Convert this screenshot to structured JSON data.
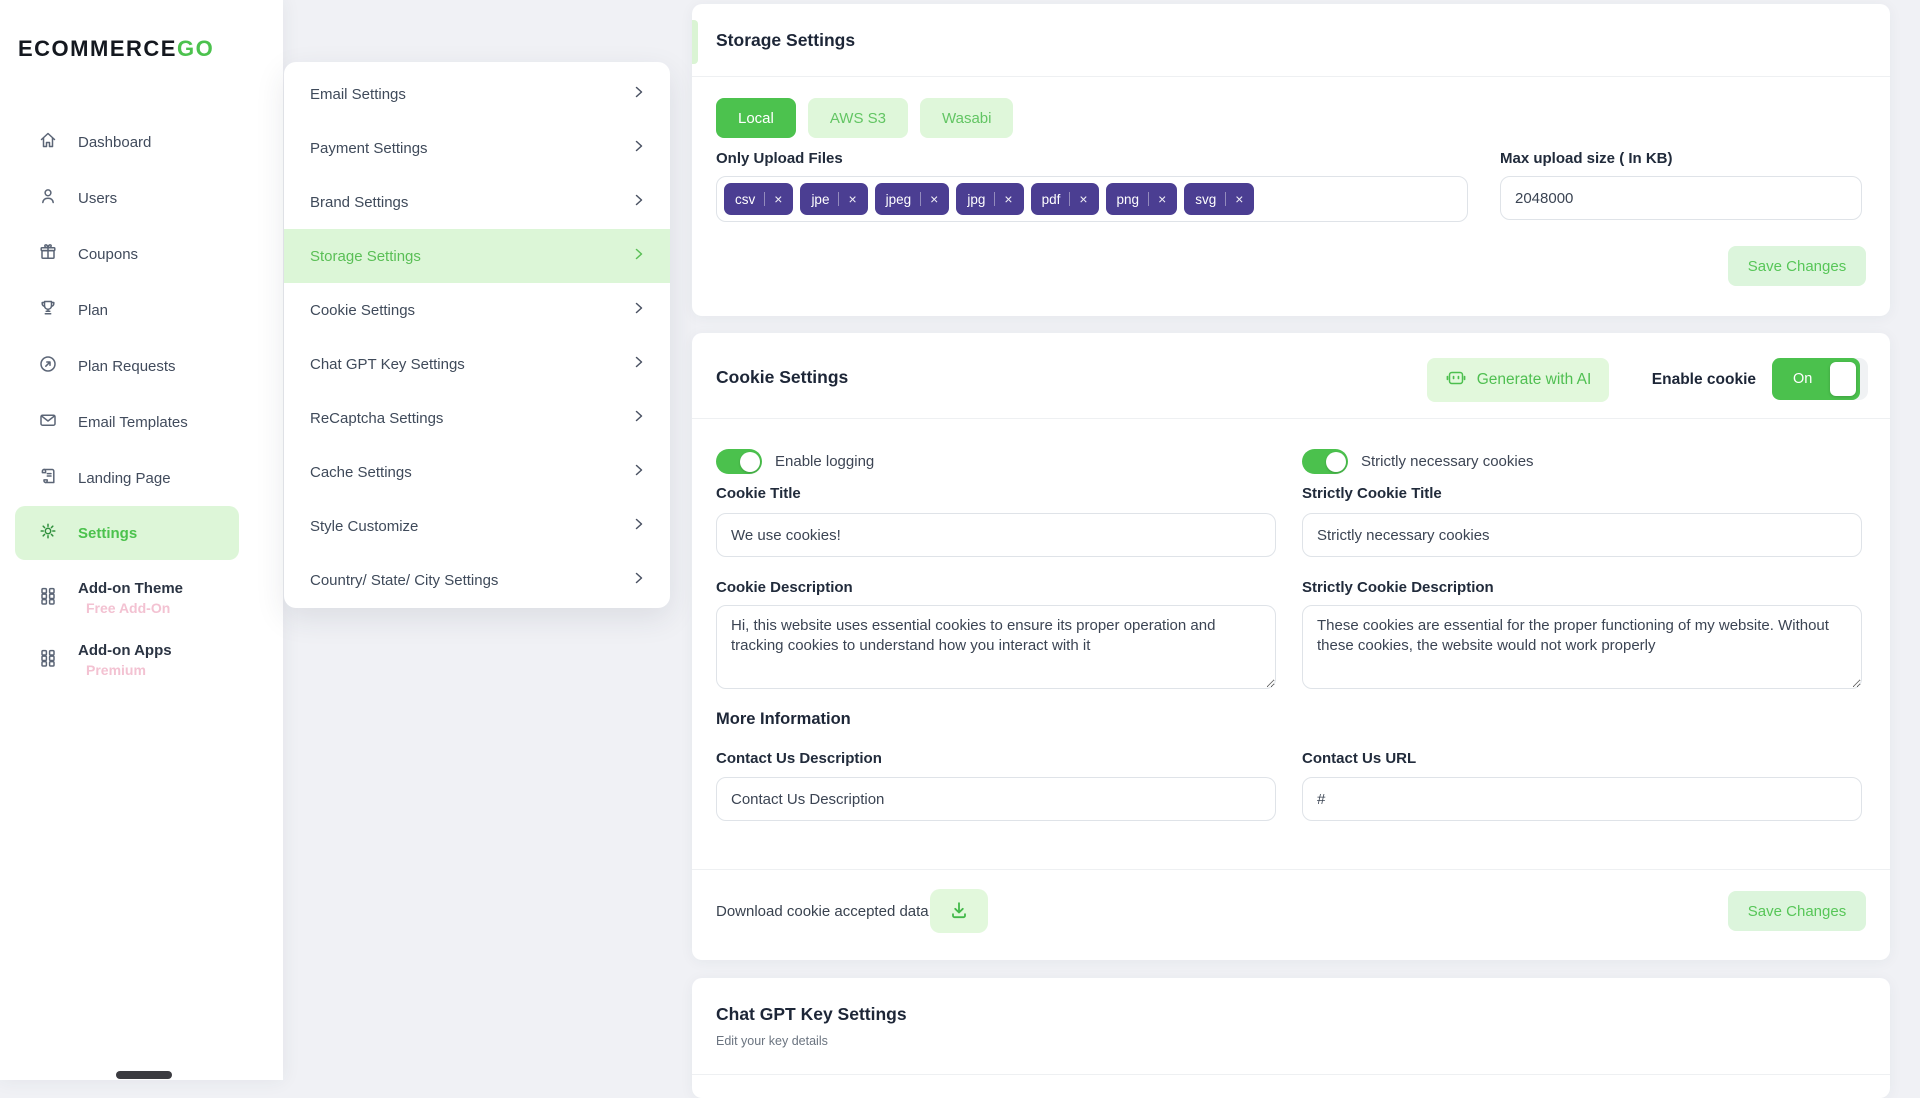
{
  "brand": {
    "name_primary": "ECOMMERCE",
    "name_accent": "GO"
  },
  "colors": {
    "primary_green": "#4cc24e",
    "light_green": "#ddf6d8",
    "tag_indigo": "#4b3e92",
    "addon_pink": "#f3c2d2"
  },
  "icons": {
    "close": "×"
  },
  "sidebar": {
    "items": [
      {
        "label": "Dashboard",
        "icon": "home"
      },
      {
        "label": "Users",
        "icon": "user"
      },
      {
        "label": "Coupons",
        "icon": "gift"
      },
      {
        "label": "Plan",
        "icon": "trophy"
      },
      {
        "label": "Plan Requests",
        "icon": "arrow-up-right-circle"
      },
      {
        "label": "Email Templates",
        "icon": "envelope"
      },
      {
        "label": "Landing Page",
        "icon": "page"
      },
      {
        "label": "Settings",
        "icon": "gear",
        "active": true
      }
    ],
    "addons": [
      {
        "label": "Add-on Theme",
        "sublabel": "Free Add-On",
        "icon": "grid"
      },
      {
        "label": "Add-on Apps",
        "sublabel": "Premium",
        "icon": "grid"
      }
    ]
  },
  "settings_menu": {
    "items": [
      {
        "label": "Email Settings"
      },
      {
        "label": "Payment Settings"
      },
      {
        "label": "Brand Settings"
      },
      {
        "label": "Storage Settings",
        "active": true
      },
      {
        "label": "Cookie Settings"
      },
      {
        "label": "Chat GPT Key Settings"
      },
      {
        "label": "ReCaptcha Settings"
      },
      {
        "label": "Cache Settings"
      },
      {
        "label": "Style Customize"
      },
      {
        "label": "Country/ State/ City Settings"
      }
    ]
  },
  "storage": {
    "title": "Storage Settings",
    "tabs": [
      {
        "label": "Local",
        "active": true
      },
      {
        "label": "AWS S3",
        "active": false
      },
      {
        "label": "Wasabi",
        "active": false
      }
    ],
    "upload_files_label": "Only Upload Files",
    "file_tags": [
      "csv",
      "jpe",
      "jpeg",
      "jpg",
      "pdf",
      "png",
      "svg"
    ],
    "max_upload_label": "Max upload size ( In KB)",
    "max_upload_value": "2048000",
    "save_label": "Save Changes"
  },
  "cookie": {
    "title": "Cookie Settings",
    "generate_ai_label": "Generate with AI",
    "enable_cookie_label": "Enable cookie",
    "enable_cookie_state": "On",
    "left": {
      "toggle_label": "Enable logging",
      "title_label": "Cookie Title",
      "title_value": "We use cookies!",
      "desc_label": "Cookie Description",
      "desc_value": "Hi, this website uses essential cookies to ensure its proper operation and tracking cookies to understand how you interact with it"
    },
    "right": {
      "toggle_label": "Strictly necessary cookies",
      "title_label": "Strictly Cookie Title",
      "title_value": "Strictly necessary cookies",
      "desc_label": "Strictly Cookie Description",
      "desc_value": "These cookies are essential for the proper functioning of my website. Without these cookies, the website would not work properly"
    },
    "more_info": {
      "heading": "More Information",
      "contact_desc_label": "Contact Us Description",
      "contact_desc_value": "Contact Us Description",
      "contact_url_label": "Contact Us URL",
      "contact_url_value": "#"
    },
    "download_label": "Download cookie accepted data",
    "save_label": "Save Changes"
  },
  "chatgpt": {
    "title": "Chat GPT Key Settings",
    "subtitle": "Edit your key details"
  }
}
